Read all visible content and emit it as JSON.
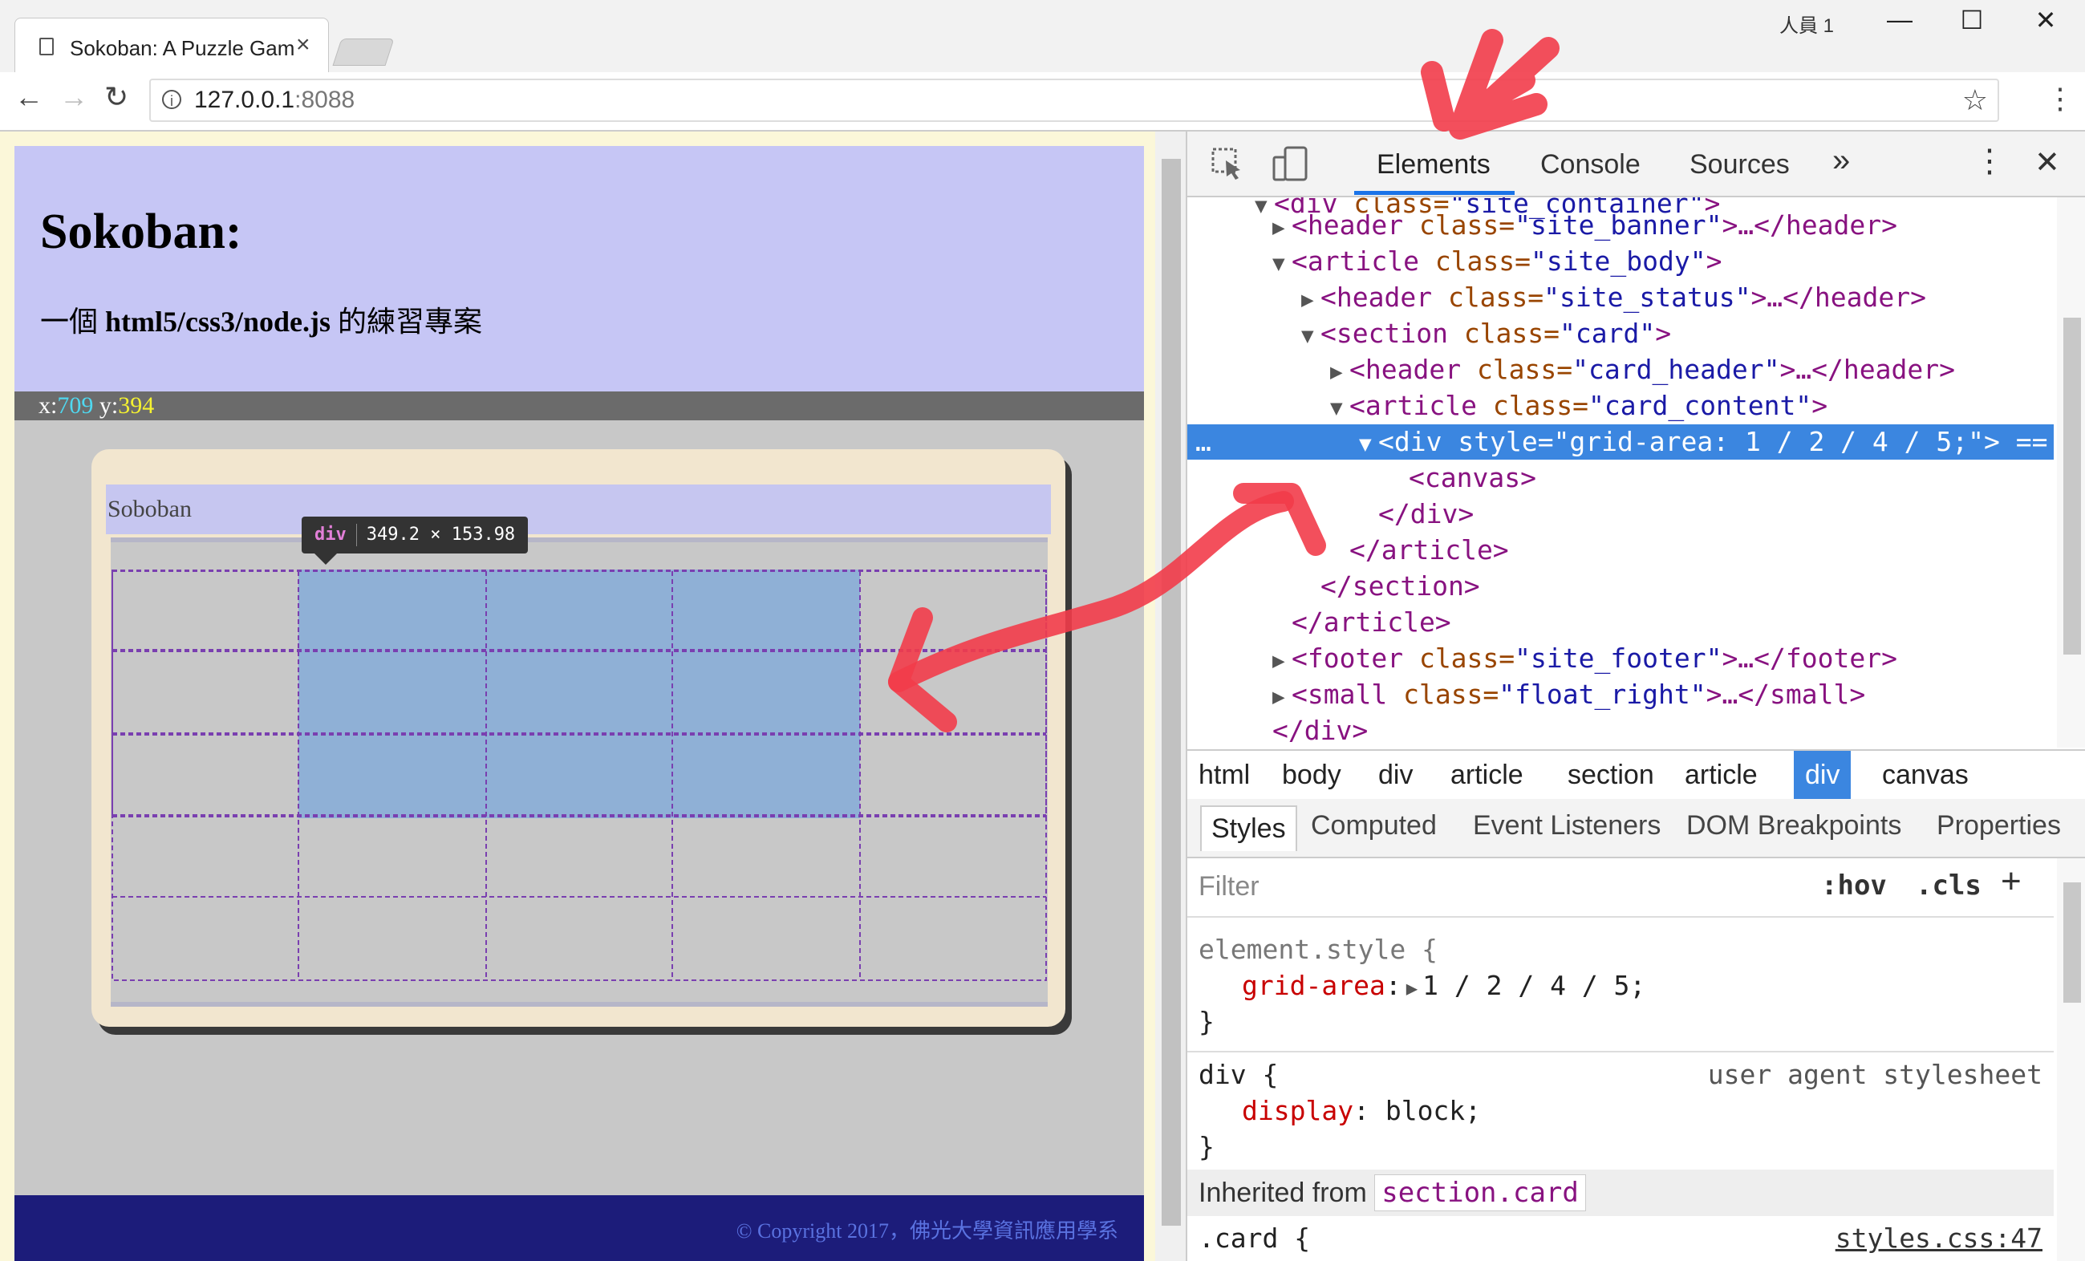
{
  "browser": {
    "tab_title": "Sokoban: A Puzzle Gam",
    "tab_close": "×",
    "profile_label": "人員 1",
    "minimize": "—",
    "maximize": "☐",
    "close": "✕",
    "url_host": "127.0.0.1",
    "url_port": ":8088",
    "back": "←",
    "forward": "→",
    "reload": "↻",
    "info": "i",
    "star": "☆",
    "menu": "⋮"
  },
  "page": {
    "banner_title": "Sokoban:",
    "banner_subtitle_prefix": "一個 ",
    "banner_subtitle_bold": "html5/css3/node.js",
    "banner_subtitle_suffix": " 的練習專案",
    "status_x_label": "x:",
    "status_x_value": "709",
    "status_y_label": " y:",
    "status_y_value": "394",
    "card_header": "Soboban",
    "footer": "© Copyright 2017，佛光大學資訊應用學系"
  },
  "tooltip": {
    "tag": "div",
    "size": "349.2 × 153.98"
  },
  "devtools": {
    "tabs": [
      "Elements",
      "Console",
      "Sources"
    ],
    "more_tabs": "»",
    "kebab": "⋮",
    "close": "✕",
    "tree": [
      {
        "arrow": "▼",
        "tag": "<div",
        "attr": " class=",
        "val": "\"site_container\"",
        "end": ">"
      },
      {
        "arrow": "▶",
        "tag": "<header",
        "attr": " class=",
        "val": "\"site_banner\"",
        "end": ">…</header>"
      },
      {
        "arrow": "▼",
        "tag": "<article",
        "attr": " class=",
        "val": "\"site_body\"",
        "end": ">"
      },
      {
        "arrow": "▶",
        "tag": "<header",
        "attr": " class=",
        "val": "\"site_status\"",
        "end": ">…</header>"
      },
      {
        "arrow": "▼",
        "tag": "<section",
        "attr": " class=",
        "val": "\"card\"",
        "end": ">"
      },
      {
        "arrow": "▶",
        "tag": "<header",
        "attr": " class=",
        "val": "\"card_header\"",
        "end": ">…</header>"
      },
      {
        "arrow": "▼",
        "tag": "<article",
        "attr": " class=",
        "val": "\"card_content\"",
        "end": ">"
      },
      {
        "arrow": "▼",
        "tag": "<div",
        "attr": " style=",
        "val": "\"grid-area: 1 / 2 / 4 / 5;\"",
        "end": "> =="
      },
      {
        "arrow": "",
        "tag": "<canvas>",
        "attr": "",
        "val": "",
        "end": ""
      },
      {
        "arrow": "",
        "tag": "</div>",
        "attr": "",
        "val": "",
        "end": ""
      },
      {
        "arrow": "",
        "tag": "</article>",
        "attr": "",
        "val": "",
        "end": ""
      },
      {
        "arrow": "",
        "tag": "</section>",
        "attr": "",
        "val": "",
        "end": ""
      },
      {
        "arrow": "",
        "tag": "</article>",
        "attr": "",
        "val": "",
        "end": ""
      },
      {
        "arrow": "▶",
        "tag": "<footer",
        "attr": " class=",
        "val": "\"site_footer\"",
        "end": ">…</footer>"
      },
      {
        "arrow": "▶",
        "tag": "<small",
        "attr": " class=",
        "val": "\"float_right\"",
        "end": ">…</small>"
      },
      {
        "arrow": "",
        "tag": "</div>",
        "attr": "",
        "val": "",
        "end": ""
      }
    ],
    "selected_prefix": "…",
    "breadcrumbs": [
      "html",
      "body",
      "div",
      "article",
      "section",
      "article",
      "div",
      "canvas"
    ],
    "style_tabs": [
      "Styles",
      "Computed",
      "Event Listeners",
      "DOM Breakpoints",
      "Properties"
    ],
    "filter_placeholder": "Filter",
    "hov": ":hov",
    "cls": ".cls",
    "plus": "+",
    "rules": {
      "element_style_selector": "element.style {",
      "grid_area_prop": "grid-area",
      "grid_area_value": "1 / 2 / 4 / 5;",
      "close_brace": "}",
      "div_selector": "div {",
      "div_origin": "user agent stylesheet",
      "display_prop": "display",
      "display_value": "block;",
      "inherited_label": "Inherited from ",
      "inherited_link": "section.card",
      "card_selector": ".card {",
      "card_source": "styles.css:47"
    }
  },
  "colors": {
    "banner": "#c6c6f5",
    "status_bar": "#6b6b6b",
    "coord_x": "#4fd8f0",
    "coord_y": "#f5f230",
    "footer": "#1c1c7a",
    "selection": "#3b86e0",
    "grid_highlight": "#8fb0d6",
    "annotation": "#f23c4a"
  }
}
